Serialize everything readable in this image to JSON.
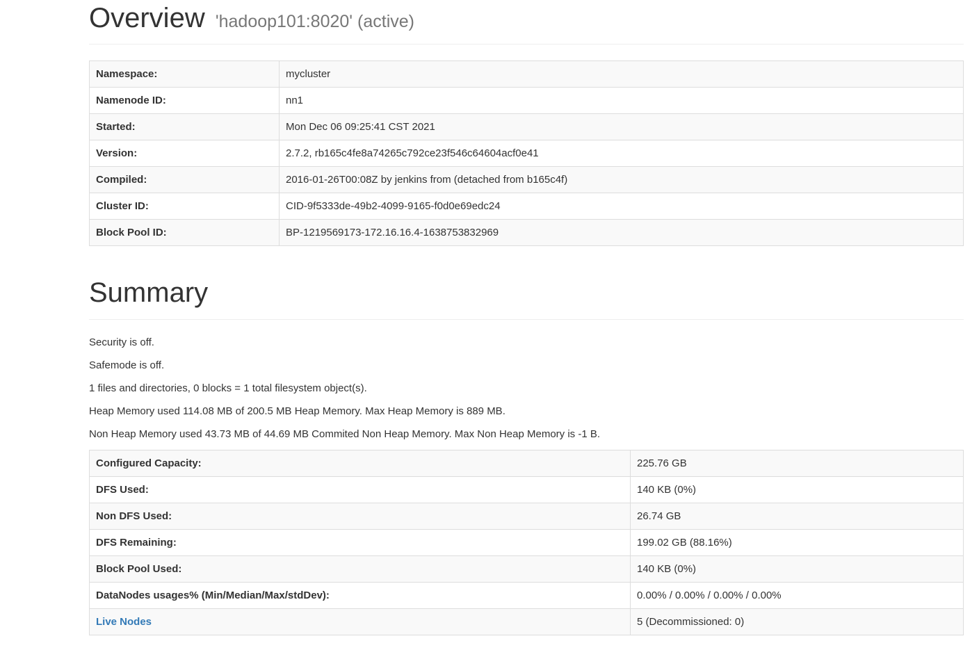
{
  "overview": {
    "title": "Overview",
    "subtitle": "'hadoop101:8020' (active)",
    "rows": [
      {
        "label": "Namespace:",
        "value": "mycluster"
      },
      {
        "label": "Namenode ID:",
        "value": "nn1"
      },
      {
        "label": "Started:",
        "value": "Mon Dec 06 09:25:41 CST 2021"
      },
      {
        "label": "Version:",
        "value": "2.7.2, rb165c4fe8a74265c792ce23f546c64604acf0e41"
      },
      {
        "label": "Compiled:",
        "value": "2016-01-26T00:08Z by jenkins from (detached from b165c4f)"
      },
      {
        "label": "Cluster ID:",
        "value": "CID-9f5333de-49b2-4099-9165-f0d0e69edc24"
      },
      {
        "label": "Block Pool ID:",
        "value": "BP-1219569173-172.16.16.4-1638753832969"
      }
    ]
  },
  "summary": {
    "title": "Summary",
    "lines": [
      "Security is off.",
      "Safemode is off.",
      "1 files and directories, 0 blocks = 1 total filesystem object(s).",
      "Heap Memory used 114.08 MB of 200.5 MB Heap Memory. Max Heap Memory is 889 MB.",
      "Non Heap Memory used 43.73 MB of 44.69 MB Commited Non Heap Memory. Max Non Heap Memory is -1 B."
    ],
    "rows": [
      {
        "label": "Configured Capacity:",
        "value": "225.76 GB"
      },
      {
        "label": "DFS Used:",
        "value": "140 KB (0%)"
      },
      {
        "label": "Non DFS Used:",
        "value": "26.74 GB"
      },
      {
        "label": "DFS Remaining:",
        "value": "199.02 GB (88.16%)"
      },
      {
        "label": "Block Pool Used:",
        "value": "140 KB (0%)"
      },
      {
        "label": "DataNodes usages% (Min/Median/Max/stdDev):",
        "value": "0.00% / 0.00% / 0.00% / 0.00%"
      },
      {
        "label": "Live Nodes",
        "value": "5 (Decommissioned: 0)",
        "is_link": true
      }
    ]
  },
  "colors": {
    "link": "#337ab7",
    "stripe": "#f9f9f9",
    "border": "#dddddd",
    "subtitle": "#777777"
  }
}
